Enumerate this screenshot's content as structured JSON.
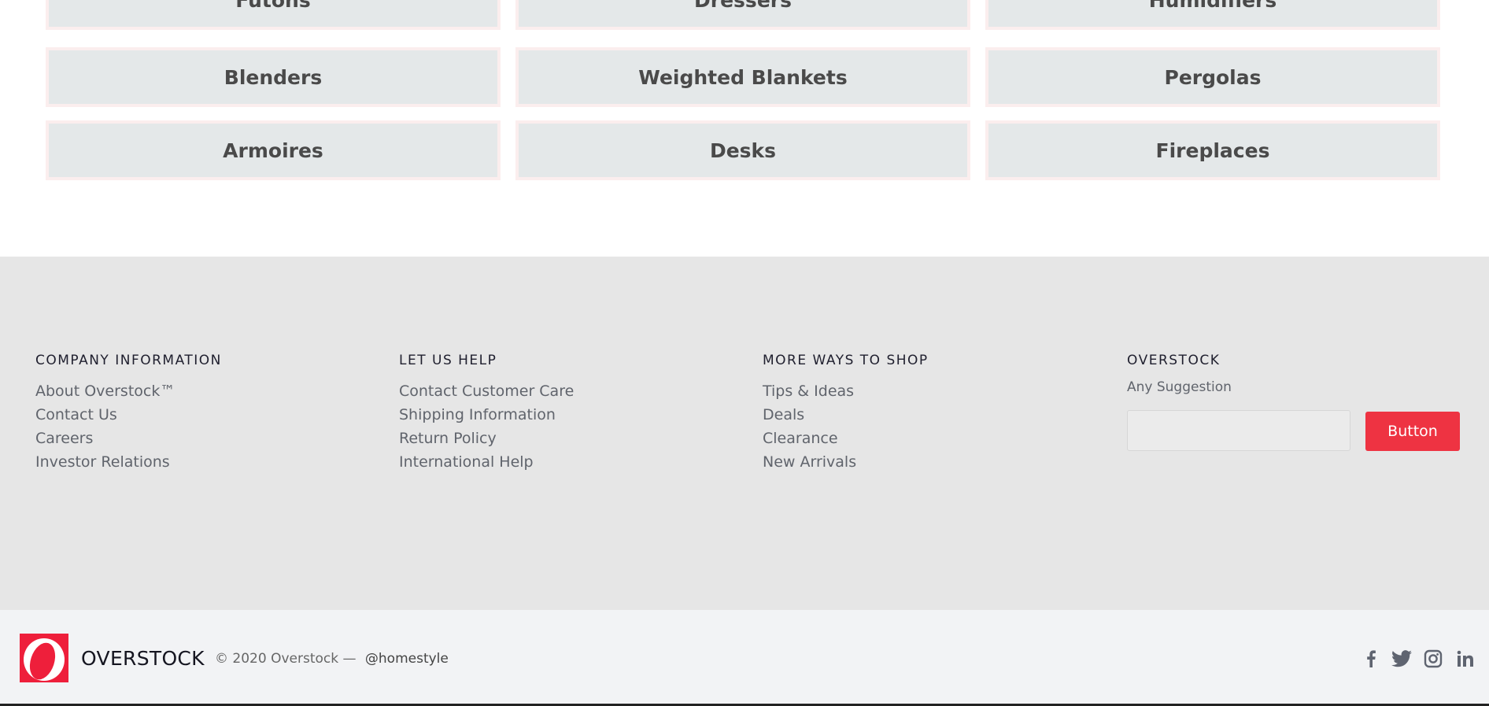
{
  "categories": [
    "Futons",
    "Dressers",
    "Humidifiers",
    "Blenders",
    "Weighted Blankets",
    "Pergolas",
    "Armoires",
    "Desks",
    "Fireplaces"
  ],
  "footer": {
    "columns": [
      {
        "title": "COMPANY INFORMATION",
        "links": [
          "About Overstock™",
          "Contact Us",
          "Careers",
          "Investor Relations"
        ]
      },
      {
        "title": "LET US HELP",
        "links": [
          "Contact Customer Care",
          "Shipping Information",
          "Return Policy",
          "International Help"
        ]
      },
      {
        "title": "MORE WAYS TO SHOP",
        "links": [
          "Tips & Ideas",
          "Deals",
          "Clearance",
          "New Arrivals"
        ]
      }
    ],
    "overstock": {
      "title": "OVERSTOCK",
      "label": "Any Suggestion",
      "input_value": "",
      "button_label": "Button"
    }
  },
  "bottom": {
    "brand": "OVERSTOCK",
    "copyright": "© 2020 Overstock —",
    "handle": "@homestyle",
    "social_icons": [
      "facebook-icon",
      "twitter-icon",
      "instagram-icon",
      "linkedin-icon"
    ]
  },
  "colors": {
    "accent": "#ee3342",
    "footer_bg": "#e6e6e6",
    "bottom_bg": "#f2f3f5",
    "tile_bg": "#e4e8e9"
  }
}
